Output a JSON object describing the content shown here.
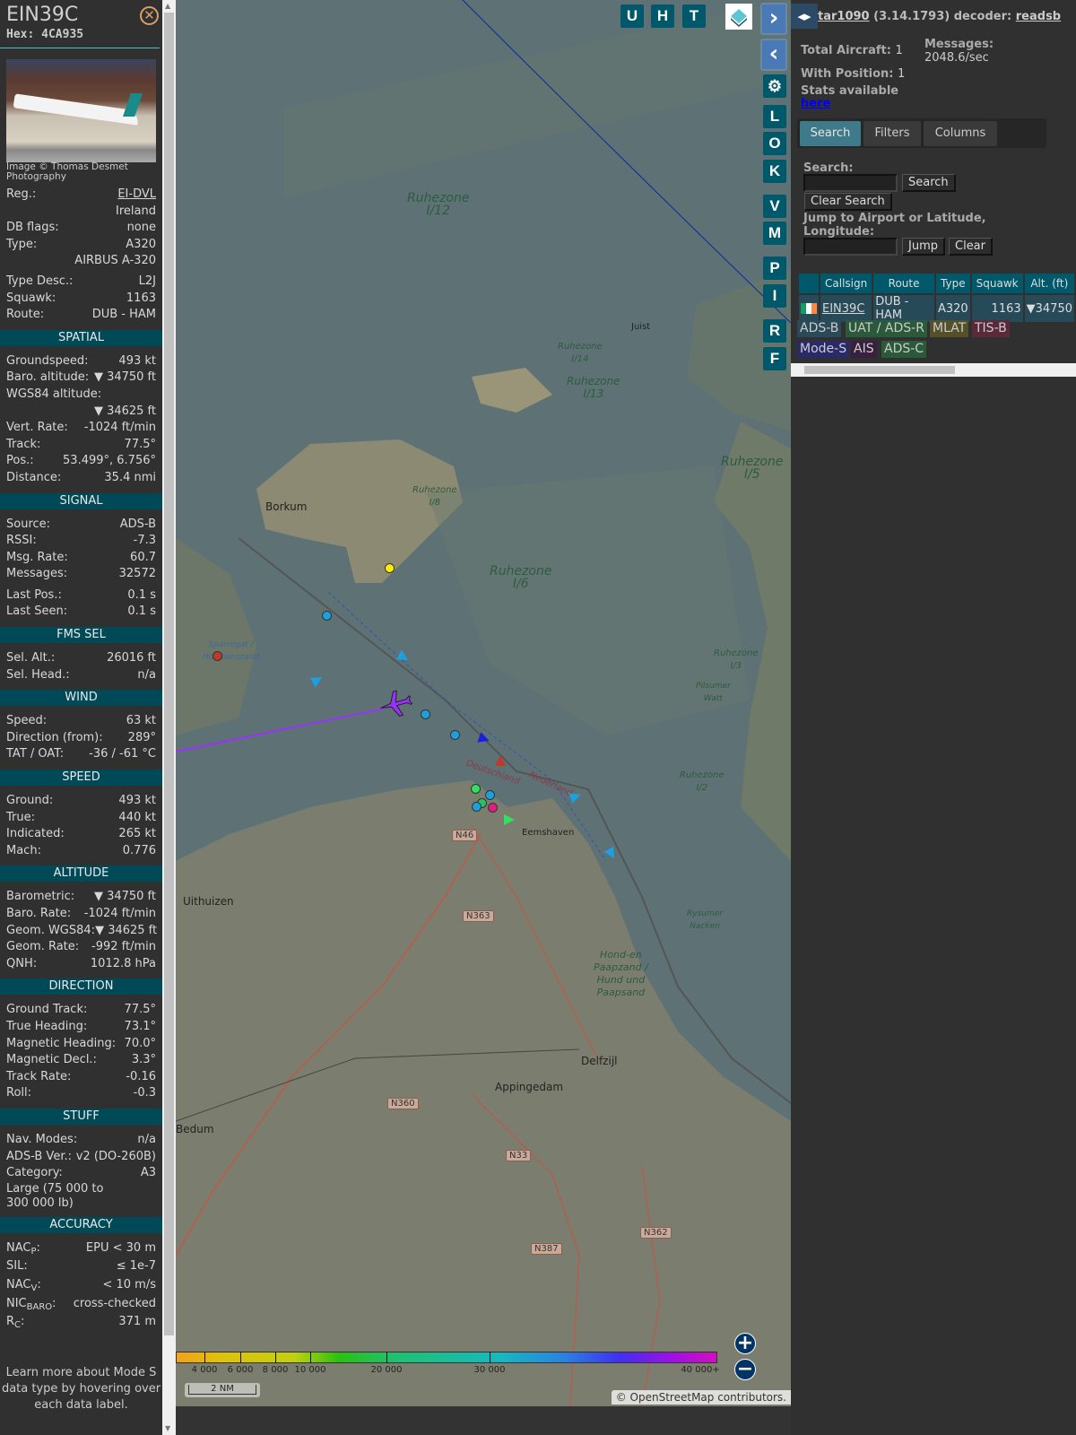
{
  "sidebar": {
    "callsign": "EIN39C",
    "hex_label": "Hex:",
    "hex": "4CA935",
    "close_icon": "circle-x-icon",
    "photo_caption": "Image © Thomas Desmet Photography",
    "info": [
      {
        "label": "Reg.:",
        "value": "EI-DVL"
      },
      {
        "label": "",
        "value": "Ireland"
      },
      {
        "label": "DB flags:",
        "value": "none"
      },
      {
        "label": "Type:",
        "value": "A320"
      },
      {
        "label": "",
        "value": "AIRBUS A-320"
      },
      {
        "label": "Type Desc.:",
        "value": "L2J"
      },
      {
        "label": "Squawk:",
        "value": "1163"
      },
      {
        "label": "Route:",
        "value": "DUB - HAM"
      }
    ],
    "spatial": {
      "title": "SPATIAL",
      "rows": [
        {
          "label": "Groundspeed:",
          "value": "493 kt"
        },
        {
          "label": "Baro. altitude:",
          "value": "▼ 34750 ft"
        },
        {
          "label": "WGS84 altitude:",
          "value": ""
        },
        {
          "label": "",
          "value": "▼ 34625 ft"
        },
        {
          "label": "Vert. Rate:",
          "value": "-1024 ft/min"
        },
        {
          "label": "Track:",
          "value": "77.5°"
        },
        {
          "label": "Pos.:",
          "value": "53.499°, 6.756°"
        },
        {
          "label": "Distance:",
          "value": "35.4 nmi"
        }
      ]
    },
    "signal": {
      "title": "SIGNAL",
      "rows": [
        {
          "label": "Source:",
          "value": "ADS-B"
        },
        {
          "label": "RSSI:",
          "value": "-7.3"
        },
        {
          "label": "Msg. Rate:",
          "value": "60.7"
        },
        {
          "label": "Messages:",
          "value": "32572"
        },
        {
          "label": "Last Pos.:",
          "value": "0.1 s"
        },
        {
          "label": "Last Seen:",
          "value": "0.1 s"
        }
      ]
    },
    "fms": {
      "title": "FMS SEL",
      "rows": [
        {
          "label": "Sel. Alt.:",
          "value": "26016 ft"
        },
        {
          "label": "Sel. Head.:",
          "value": "n/a"
        }
      ]
    },
    "wind": {
      "title": "WIND",
      "rows": [
        {
          "label": "Speed:",
          "value": "63 kt"
        },
        {
          "label": "Direction (from):",
          "value": "289°"
        },
        {
          "label": "TAT / OAT:",
          "value": "-36 / -61 °C"
        }
      ]
    },
    "speed": {
      "title": "SPEED",
      "rows": [
        {
          "label": "Ground:",
          "value": "493 kt"
        },
        {
          "label": "True:",
          "value": "440 kt"
        },
        {
          "label": "Indicated:",
          "value": "265 kt"
        },
        {
          "label": "Mach:",
          "value": "0.776"
        }
      ]
    },
    "altitude": {
      "title": "ALTITUDE",
      "rows": [
        {
          "label": "Barometric:",
          "value": "▼ 34750 ft"
        },
        {
          "label": "Baro. Rate:",
          "value": "-1024 ft/min"
        },
        {
          "label": "Geom. WGS84:",
          "value": "▼ 34625 ft"
        },
        {
          "label": "Geom. Rate:",
          "value": "-992 ft/min"
        },
        {
          "label": "QNH:",
          "value": "1012.8 hPa"
        }
      ]
    },
    "direction": {
      "title": "DIRECTION",
      "rows": [
        {
          "label": "Ground Track:",
          "value": "77.5°"
        },
        {
          "label": "True Heading:",
          "value": "73.1°"
        },
        {
          "label": "Magnetic Heading:",
          "value": "70.0°"
        },
        {
          "label": "Magnetic Decl.:",
          "value": "3.3°"
        },
        {
          "label": "Track Rate:",
          "value": "-0.16"
        },
        {
          "label": "Roll:",
          "value": "-0.3"
        }
      ]
    },
    "stuff": {
      "title": "STUFF",
      "rows": [
        {
          "label": "Nav. Modes:",
          "value": "n/a"
        },
        {
          "label": "ADS-B Ver.:",
          "value": "v2 (DO-260B)"
        },
        {
          "label": "Category:",
          "value": "A3"
        }
      ],
      "category_desc": "Large (75 000 to 300 000 lb)"
    },
    "accuracy": {
      "title": "ACCURACY",
      "rows": [
        {
          "label": "NAC",
          "sub": "P",
          "value": "EPU < 30 m"
        },
        {
          "label": "SIL",
          "sub": "",
          "value": "≤ 1e-7"
        },
        {
          "label": "NAC",
          "sub": "V",
          "value": "< 10 m/s"
        },
        {
          "label": "NIC",
          "sub": "BARO",
          "value": "cross-checked"
        },
        {
          "label": "R",
          "sub": "C",
          "value": "371 m"
        }
      ]
    },
    "footer": "Learn more about Mode S data type by hovering over each data label."
  },
  "map": {
    "top_buttons": [
      "U",
      "H",
      "T"
    ],
    "side_buttons": [
      "L",
      "O",
      "K",
      "V",
      "M",
      "P",
      "I",
      "R",
      "F"
    ],
    "labels": [
      {
        "text": "Ruhezone\nI/12",
        "kind": "big"
      },
      {
        "text": "Ruhezone\nI/14",
        "kind": "small"
      },
      {
        "text": "Ruhezone\nI/13",
        "kind": "small"
      },
      {
        "text": "Ruhezone\nI/5",
        "kind": "big"
      },
      {
        "text": "Ruhezone\nI/8",
        "kind": "small"
      },
      {
        "text": "Ruhezone\nI/6",
        "kind": "big"
      },
      {
        "text": "Ruhezone\nI/2",
        "kind": "small"
      },
      {
        "text": "Ruhezone\nI/3",
        "kind": "small"
      },
      {
        "text": "Hond-en\nPaapzand /\nHund und\nPaapsand",
        "kind": "small"
      },
      {
        "text": "Borkum",
        "kind": "town"
      },
      {
        "text": "Uithuizen",
        "kind": "town"
      },
      {
        "text": "Eemshaven",
        "kind": "town"
      },
      {
        "text": "Delfzijl",
        "kind": "town"
      },
      {
        "text": "Appingedam",
        "kind": "town"
      },
      {
        "text": "Bedum",
        "kind": "town"
      },
      {
        "text": "Juist",
        "kind": "town"
      },
      {
        "text": "Deutschland",
        "kind": "small"
      },
      {
        "text": "Nederland",
        "kind": "small"
      },
      {
        "text": "Pilsumer\nWatt",
        "kind": "small"
      },
      {
        "text": "Rysumer\nNacken",
        "kind": "small"
      },
      {
        "text": "Sparregat /\nHorsbornzand",
        "kind": "small"
      }
    ],
    "roads": [
      "N46",
      "N363",
      "N360",
      "N33",
      "N387",
      "N362"
    ],
    "colorbar": {
      "ticks": [
        "4 000",
        "6 000",
        "8 000",
        "10 000",
        "20 000",
        "30 000",
        "40 000+"
      ]
    },
    "scale": "2 NM",
    "attribution": "© OpenStreetMap contributors.",
    "aircraft_color": "#9b30ff"
  },
  "right": {
    "header_prefix": "tar1090",
    "header_version": "(3.14.1793) decoder:",
    "decoder": "readsb",
    "total_aircraft_label": "Total Aircraft:",
    "total_aircraft": "1",
    "with_position_label": "With Position:",
    "with_position": "1",
    "messages_label": "Messages:",
    "messages": "2048.6/sec",
    "stats_text": "Stats available",
    "stats_link": "here",
    "tabs": [
      "Search",
      "Filters",
      "Columns"
    ],
    "search_label": "Search:",
    "search_value": "",
    "search_button": "Search",
    "clear_search_button": "Clear Search",
    "jump_label": "Jump to Airport or Latitude, Longitude:",
    "jump_value": "",
    "jump_button": "Jump",
    "clear_button": "Clear",
    "table": {
      "columns": [
        "",
        "Callsign",
        "Route",
        "Type",
        "Squawk",
        "Alt. (ft)"
      ],
      "rows": [
        {
          "callsign": "EIN39C",
          "route": "DUB - HAM",
          "type": "A320",
          "squawk": "1163",
          "alt": "▼34750"
        }
      ]
    },
    "legend": [
      {
        "label": "ADS-B",
        "color": "#2a4a5a"
      },
      {
        "label": "UAT / ADS-R",
        "color": "#2a5a3a"
      },
      {
        "label": "MLAT",
        "color": "#55502a"
      },
      {
        "label": "TIS-B",
        "color": "#5a2a3a"
      },
      {
        "label": "Mode-S",
        "color": "#2a2a6a"
      },
      {
        "label": "AIS",
        "color": "#3a2040"
      },
      {
        "label": "ADS-C",
        "color": "#2a5a3a"
      }
    ]
  }
}
